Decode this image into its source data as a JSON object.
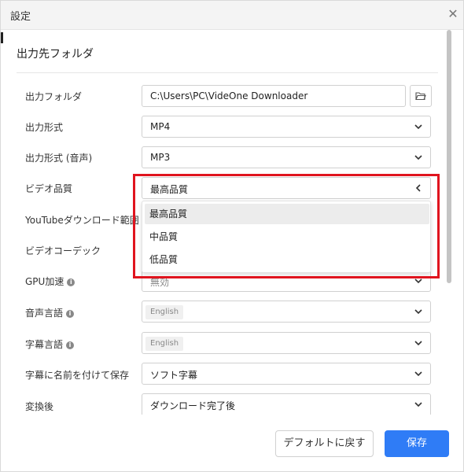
{
  "window": {
    "title": "設定",
    "close_glyph": "✕"
  },
  "section": {
    "title": "出力先フォルダ"
  },
  "rows": {
    "output_folder": {
      "label": "出力フォルダ",
      "value": "C:\\Users\\PC\\VideOne Downloader"
    },
    "output_format": {
      "label": "出力形式",
      "value": "MP4"
    },
    "output_format_audio": {
      "label": "出力形式 (音声)",
      "value": "MP3"
    },
    "video_quality": {
      "label": "ビデオ品質",
      "value": "最高品質"
    },
    "youtube_range": {
      "label": "YouTubeダウンロード範囲"
    },
    "video_codec": {
      "label": "ビデオコーデック"
    },
    "gpu": {
      "label": "GPU加速",
      "value": "無効"
    },
    "audio_lang": {
      "label": "音声言語",
      "tag": "English"
    },
    "subtitle_lang": {
      "label": "字幕言語",
      "tag": "English"
    },
    "save_subtitle": {
      "label": "字幕に名前を付けて保存",
      "value": "ソフト字幕"
    },
    "after_convert": {
      "label": "変換後",
      "value": "ダウンロード完了後"
    }
  },
  "dropdown": {
    "options": [
      "最高品質",
      "中品質",
      "低品質"
    ],
    "selected_index": 0
  },
  "buttons": {
    "default_label": "デフォルトに戻す",
    "save_label": "保存"
  },
  "icons": {
    "info": "i"
  },
  "colors": {
    "accent": "#2f7cf6",
    "highlight": "#e0141e"
  }
}
